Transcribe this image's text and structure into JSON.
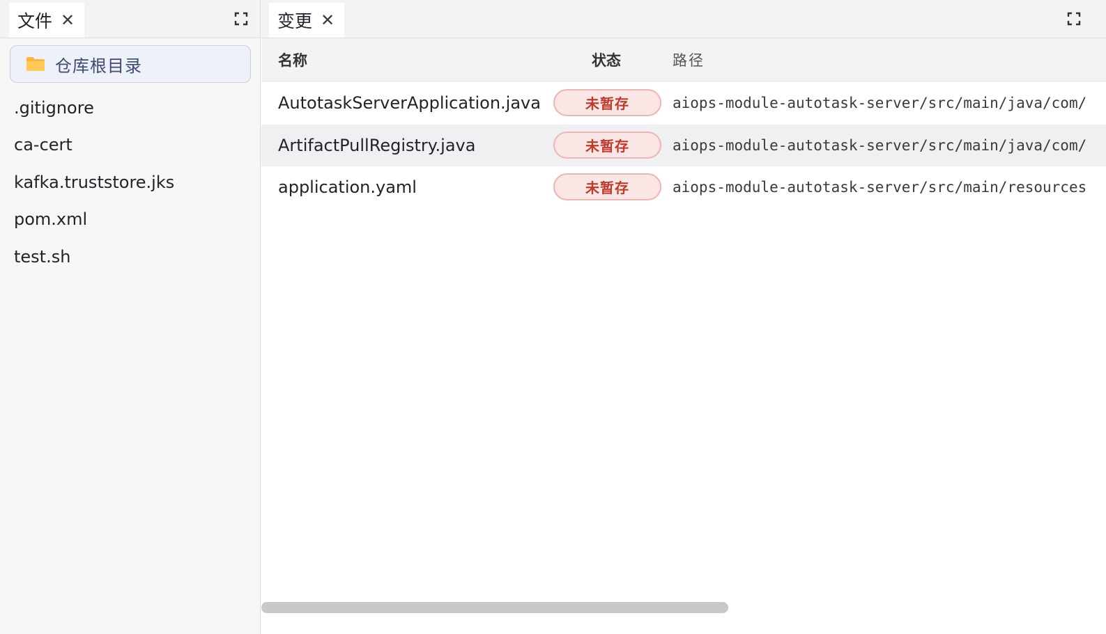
{
  "left_panel": {
    "tab": {
      "label": "文件",
      "close_glyph": "✕"
    },
    "expand_icon": "expand-icon",
    "root_dir": {
      "label": "仓库根目录",
      "icon": "folder-icon",
      "icon_color": "#f6b73c"
    },
    "files": [
      {
        "name": ".gitignore"
      },
      {
        "name": "ca-cert"
      },
      {
        "name": "kafka.truststore.jks"
      },
      {
        "name": "pom.xml"
      },
      {
        "name": "test.sh"
      }
    ]
  },
  "right_panel": {
    "tab": {
      "label": "变更",
      "close_glyph": "✕"
    },
    "expand_icon": "expand-icon",
    "columns": {
      "name": "名称",
      "status": "状态",
      "path": "路径"
    },
    "rows": [
      {
        "name": "AutotaskServerApplication.java",
        "status": "未暂存",
        "path": "aiops-module-autotask-server/src/main/java/com/"
      },
      {
        "name": "ArtifactPullRegistry.java",
        "status": "未暂存",
        "path": "aiops-module-autotask-server/src/main/java/com/"
      },
      {
        "name": "application.yaml",
        "status": "未暂存",
        "path": "aiops-module-autotask-server/src/main/resources"
      }
    ],
    "status_colors": {
      "text": "#c0392b",
      "background": "#fbe6e6",
      "border": "#eeb4b4"
    }
  }
}
